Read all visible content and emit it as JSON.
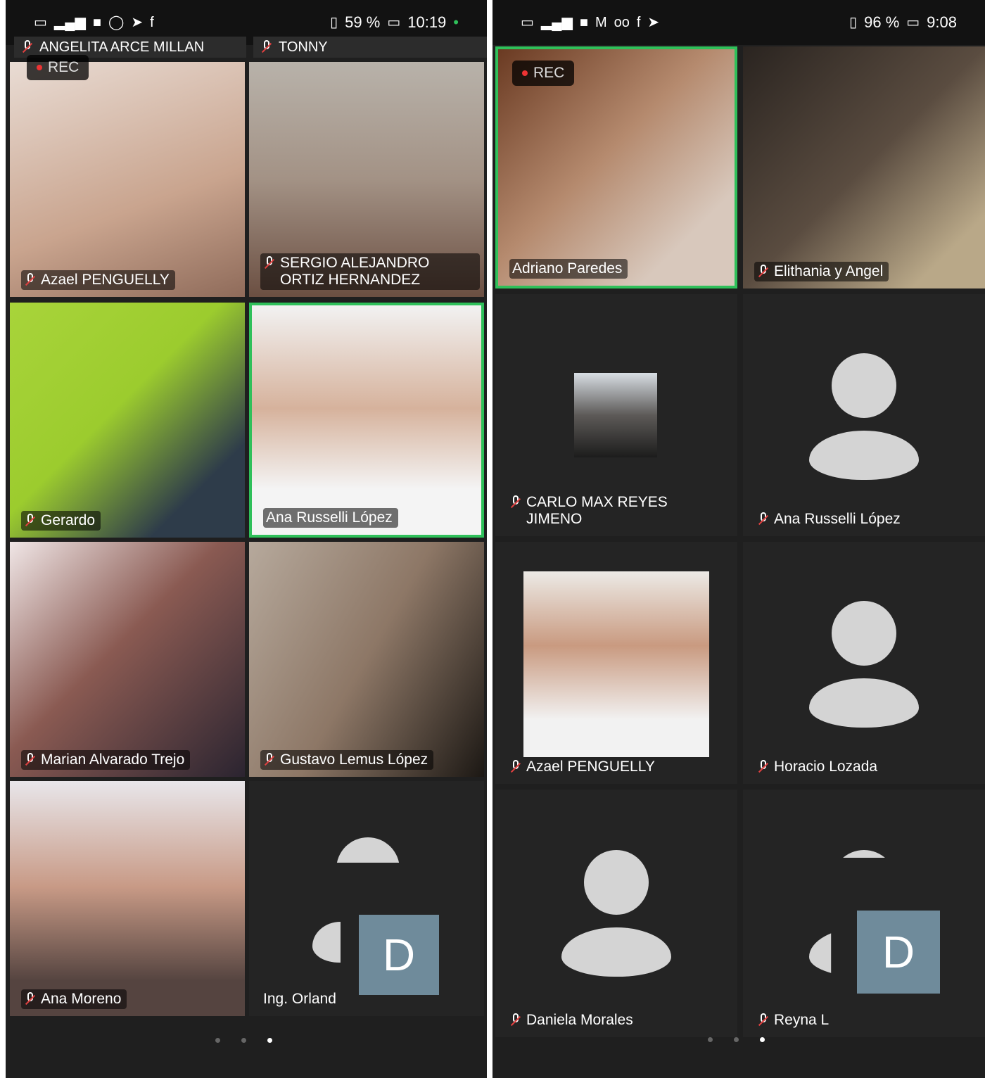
{
  "left_phone": {
    "status": {
      "battery": "59 %",
      "time": "10:19"
    },
    "top_names": [
      "ANGELITA ARCE MILLAN",
      "TONNY"
    ],
    "rec": "REC",
    "tiles": [
      {
        "name": "Azael PENGUELLY"
      },
      {
        "name": "SERGIO ALEJANDRO ORTIZ HERNANDEZ"
      },
      {
        "name": "Gerardo"
      },
      {
        "name": "Ana Russelli López"
      },
      {
        "name": "Marian Alvarado Trejo"
      },
      {
        "name": "Gustavo Lemus López"
      },
      {
        "name": "Ana Moreno"
      },
      {
        "name": "Ing. Orland"
      }
    ],
    "overlay_letter": "D"
  },
  "right_phone": {
    "status": {
      "battery": "96 %",
      "time": "9:08"
    },
    "rec": "REC",
    "tiles": [
      {
        "name": "Adriano Paredes"
      },
      {
        "name": "Elithania y Angel"
      },
      {
        "name": "CARLO MAX REYES JIMENO"
      },
      {
        "name": "Ana Russelli López"
      },
      {
        "name": "Azael PENGUELLY"
      },
      {
        "name": "Horacio Lozada"
      },
      {
        "name": "Daniela Morales"
      },
      {
        "name": "Reyna L"
      }
    ],
    "overlay_letter": "D"
  }
}
